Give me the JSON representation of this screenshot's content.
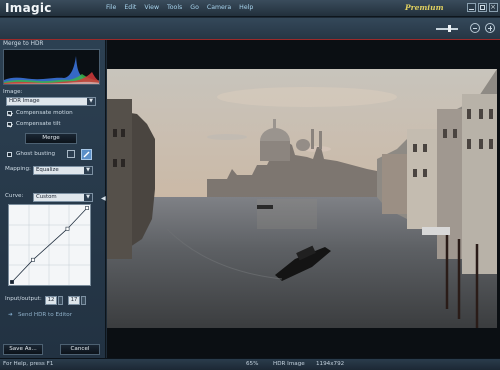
{
  "app": {
    "title": "Imagic",
    "edition": "Premium"
  },
  "menu": [
    "File",
    "Edit",
    "View",
    "Tools",
    "Go",
    "Camera",
    "Help"
  ],
  "panel": {
    "title": "Merge to HDR",
    "image_label": "Image:",
    "image_value": "HDR Image",
    "compensate_motion": {
      "label": "Compensate motion",
      "checked": true
    },
    "compensate_tilt": {
      "label": "Compensate tilt",
      "checked": true
    },
    "merge_button": "Merge",
    "ghost_busting": {
      "label": "Ghost busting",
      "checked": false
    },
    "mapping_label": "Mapping:",
    "mapping_value": "Equalize",
    "curve_label": "Curve:",
    "curve_value": "Custom",
    "curve_points": [
      [
        0,
        0
      ],
      [
        0.28,
        0.3
      ],
      [
        0.74,
        0.72
      ],
      [
        1,
        1
      ]
    ],
    "io_label": "Input/output:",
    "input_value": "12",
    "output_value": "17",
    "send_link": "Send HDR to Editor",
    "save_button": "Save As...",
    "cancel_button": "Cancel"
  },
  "status": {
    "help": "For Help, press F1",
    "zoom": "65%",
    "doc": "HDR Image",
    "dimensions": "1194x792"
  },
  "colors": {
    "accent_line": "#9c2a2a",
    "menu_text": "#a8d4ee",
    "edition_text": "#e0d060"
  }
}
